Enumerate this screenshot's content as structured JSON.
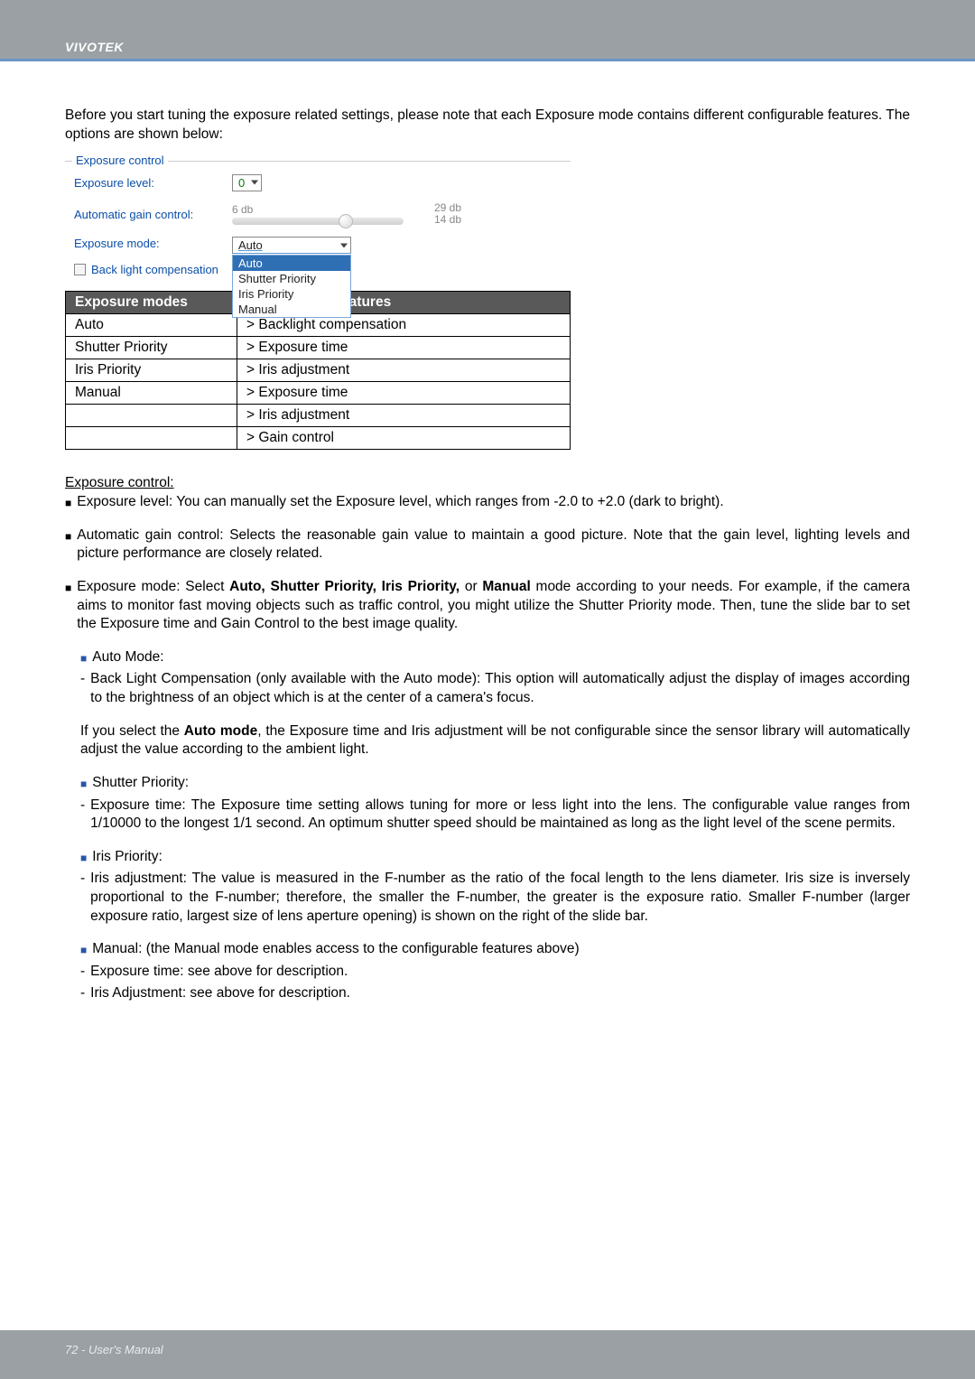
{
  "header": {
    "brand": "VIVOTEK"
  },
  "intro": "Before you start tuning the exposure related settings, please note that each Exposure mode contains different configurable features. The options are shown below:",
  "exposureControl": {
    "legend": "Exposure control",
    "levelLabel": "Exposure level:",
    "levelValue": "0",
    "agcLabel": "Automatic gain control:",
    "agcLeft": "6 db",
    "agcRightTop": "29 db",
    "agcRightBottom": "14 db",
    "modeLabel": "Exposure mode:",
    "modeSelected": "Auto",
    "modeOptions": [
      "Auto",
      "Shutter Priority",
      "Iris Priority",
      "Manual"
    ],
    "blcLabel": "Back light compensation"
  },
  "table": {
    "headers": [
      "Exposure modes",
      "Configurable features"
    ],
    "rows": [
      [
        "Auto",
        "> Backlight compensation"
      ],
      [
        "Shutter Priority",
        "> Exposure time"
      ],
      [
        "Iris Priority",
        "> Iris adjustment"
      ],
      [
        "Manual",
        "> Exposure time"
      ],
      [
        "",
        "> Iris adjustment"
      ],
      [
        "",
        "> Gain control"
      ]
    ]
  },
  "sectionTitle": "Exposure control:",
  "b_level": "Exposure level: You can manually set the Exposure level, which ranges from -2.0 to +2.0 (dark to bright).",
  "b_agc": "Automatic gain control: Selects the reasonable gain value to maintain a good picture. Note that the gain level, lighting levels and picture performance are closely related.",
  "b_mode_prefix": "Exposure mode: Select ",
  "b_mode_bold": "Auto, Shutter Priority, Iris Priority,",
  "b_mode_mid": " or ",
  "b_mode_bold2": "Manual",
  "b_mode_suffix": " mode according to your needs. For example, if the camera aims to monitor fast moving objects such as traffic control, you might utilize the Shutter Priority mode. Then, tune the slide bar to set the Exposure time and Gain Control to the best image quality.",
  "autoMode": {
    "title": "Auto Mode:",
    "blc": "Back Light Compensation (only available with the Auto mode): This option will automatically adjust the display of images according to the brightness of an object which is at the center of a camera's focus."
  },
  "autoNote_prefix": "If you select the ",
  "autoNote_bold": "Auto mode",
  "autoNote_suffix": ", the Exposure time and Iris adjustment will be not configurable since the sensor library will automatically adjust the value according to the ambient light.",
  "shutter": {
    "title": "Shutter Priority:",
    "body": "Exposure time: The Exposure time setting allows tuning for more or less light into the lens. The configurable value ranges from 1/10000 to the longest 1/1 second. An optimum shutter speed should be maintained as long as the light level of the scene permits."
  },
  "iris": {
    "title": "Iris Priority:",
    "body": "Iris adjustment: The value is measured in the F-number as the ratio of the focal length to the lens diameter. Iris size is inversely proportional to the F-number; therefore, the smaller the F-number, the greater is the exposure ratio. Smaller F-number (larger exposure ratio, largest size of lens aperture opening) is shown on the right of the slide bar."
  },
  "manual": {
    "title": "Manual: (the Manual mode enables access to the configurable features above)",
    "line1": "Exposure time: see above for description.",
    "line2": "Iris Adjustment: see above for description."
  },
  "footer": "72 - User's Manual"
}
